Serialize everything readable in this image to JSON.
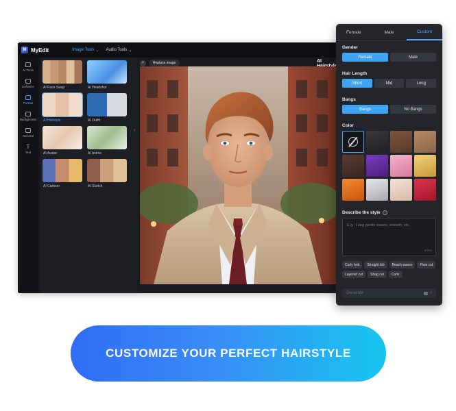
{
  "app": {
    "logo_text": "MyEdit",
    "logo_mark": "M",
    "nav": [
      {
        "label": "Image Tools",
        "active": true
      },
      {
        "label": "Audio Tools",
        "active": false
      }
    ]
  },
  "rail": [
    {
      "label": "AI Tools",
      "icon": "sparkle-icon"
    },
    {
      "label": "Enhance",
      "icon": "enhance-icon"
    },
    {
      "label": "Portrait",
      "icon": "portrait-icon",
      "active": true
    },
    {
      "label": "Background",
      "icon": "background-icon"
    },
    {
      "label": "General",
      "icon": "layers-icon"
    },
    {
      "label": "Text",
      "icon": "text-icon"
    }
  ],
  "tools": [
    {
      "label": "AI Face Swap"
    },
    {
      "label": "AI Headshot"
    },
    {
      "label": "AI Hairstyle",
      "active": true
    },
    {
      "label": "AI Outfit"
    },
    {
      "label": "AI Avatar"
    },
    {
      "label": "AI Anime"
    },
    {
      "label": "AI Cartoon"
    },
    {
      "label": "AI Sketch"
    }
  ],
  "canvas": {
    "replace_label": "Replace image",
    "title": "AI Hairstyle"
  },
  "panel": {
    "tabs": [
      {
        "label": "Female",
        "active": false
      },
      {
        "label": "Male",
        "active": false
      },
      {
        "label": "Custom",
        "active": true
      }
    ],
    "gender": {
      "label": "Gender",
      "options": [
        "Female",
        "Male"
      ],
      "selected": "Female"
    },
    "length": {
      "label": "Hair Length",
      "options": [
        "Short",
        "Mid",
        "Long"
      ],
      "selected": "Short"
    },
    "bangs": {
      "label": "Bangs",
      "options": [
        "Bangs",
        "No Bangs"
      ],
      "selected": "Bangs"
    },
    "color": {
      "label": "Color",
      "swatches": [
        "#15161a",
        "#2b2b2e",
        "#6b4632",
        "#9a6f4e",
        "#4a2f2a",
        "#5b2a8a",
        "#e69bb8",
        "#d9b45a",
        "#e4731e",
        "#c9c9cf",
        "#ead3c4",
        "#c8213b"
      ]
    },
    "describe": {
      "label": "Describe the style",
      "placeholder": "E.g.: Long gentle waves, smooth, etc.",
      "counter": "0/800"
    },
    "chips": [
      "Curly bob",
      "Straight lob",
      "Beach waves",
      "Pixie cut",
      "Layered cut",
      "Shag cut",
      "Curls"
    ],
    "generate": {
      "label": "Generate",
      "credits": "-7"
    }
  },
  "cta": {
    "label": "CUSTOMIZE YOUR PERFECT HAIRSTYLE"
  }
}
